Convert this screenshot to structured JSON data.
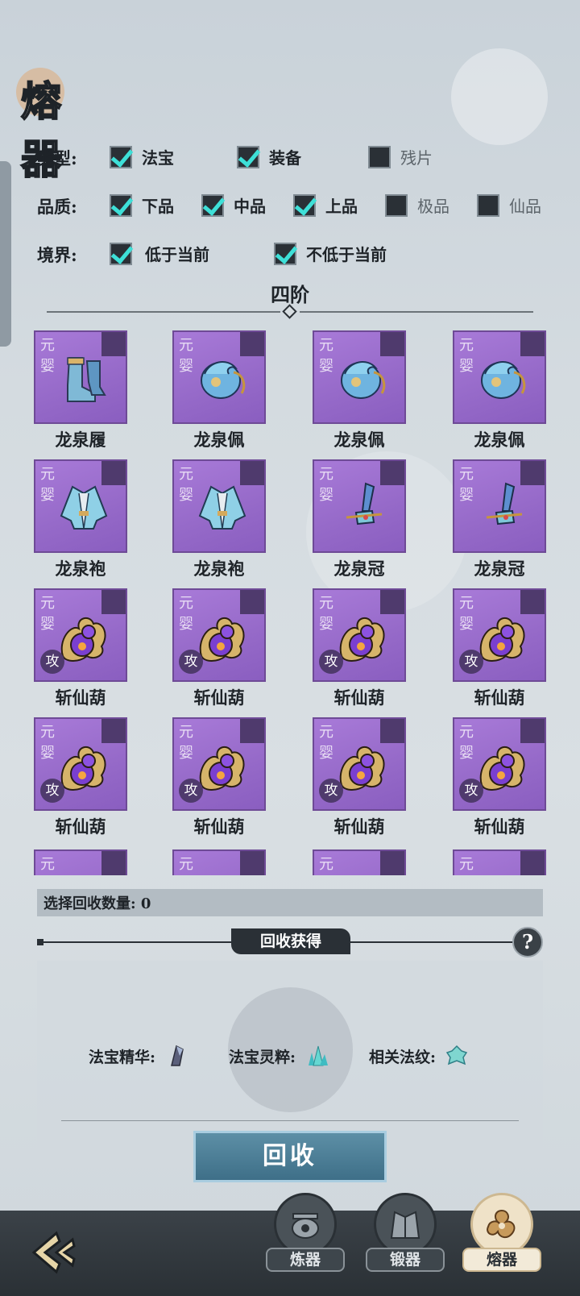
{
  "title": "熔器",
  "filters": {
    "type": {
      "label": "类型:",
      "options": [
        {
          "label": "法宝",
          "checked": true
        },
        {
          "label": "装备",
          "checked": true
        },
        {
          "label": "残片",
          "checked": false
        }
      ]
    },
    "quality": {
      "label": "品质:",
      "options": [
        {
          "label": "下品",
          "checked": true
        },
        {
          "label": "中品",
          "checked": true
        },
        {
          "label": "上品",
          "checked": true
        },
        {
          "label": "极品",
          "checked": false
        },
        {
          "label": "仙品",
          "checked": false
        }
      ]
    },
    "realm": {
      "label": "境界:",
      "options": [
        {
          "label": "低于当前",
          "checked": true
        },
        {
          "label": "不低于当前",
          "checked": true
        }
      ]
    }
  },
  "section_title": "四阶",
  "items": [
    {
      "name": "龙泉履",
      "realm": "元婴",
      "art": "boots-icon",
      "tag": ""
    },
    {
      "name": "龙泉佩",
      "realm": "元婴",
      "art": "dragon-pendant-icon",
      "tag": ""
    },
    {
      "name": "龙泉佩",
      "realm": "元婴",
      "art": "dragon-pendant-icon",
      "tag": ""
    },
    {
      "name": "龙泉佩",
      "realm": "元婴",
      "art": "dragon-pendant-icon",
      "tag": ""
    },
    {
      "name": "龙泉袍",
      "realm": "元婴",
      "art": "robe-icon",
      "tag": ""
    },
    {
      "name": "龙泉袍",
      "realm": "元婴",
      "art": "robe-icon",
      "tag": ""
    },
    {
      "name": "龙泉冠",
      "realm": "元婴",
      "art": "crown-icon",
      "tag": ""
    },
    {
      "name": "龙泉冠",
      "realm": "元婴",
      "art": "crown-icon",
      "tag": ""
    },
    {
      "name": "斩仙葫",
      "realm": "元婴",
      "art": "gourd-icon",
      "tag": "攻"
    },
    {
      "name": "斩仙葫",
      "realm": "元婴",
      "art": "gourd-icon",
      "tag": "攻"
    },
    {
      "name": "斩仙葫",
      "realm": "元婴",
      "art": "gourd-icon",
      "tag": "攻"
    },
    {
      "name": "斩仙葫",
      "realm": "元婴",
      "art": "gourd-icon",
      "tag": "攻"
    },
    {
      "name": "斩仙葫",
      "realm": "元婴",
      "art": "gourd-icon",
      "tag": "攻"
    },
    {
      "name": "斩仙葫",
      "realm": "元婴",
      "art": "gourd-icon",
      "tag": "攻"
    },
    {
      "name": "斩仙葫",
      "realm": "元婴",
      "art": "gourd-icon",
      "tag": "攻"
    },
    {
      "name": "斩仙葫",
      "realm": "元婴",
      "art": "gourd-icon",
      "tag": "攻"
    },
    {
      "name": "",
      "realm": "元",
      "art": "",
      "tag": ""
    },
    {
      "name": "",
      "realm": "元",
      "art": "",
      "tag": ""
    },
    {
      "name": "",
      "realm": "元",
      "art": "",
      "tag": ""
    },
    {
      "name": "",
      "realm": "元",
      "art": "",
      "tag": ""
    }
  ],
  "count_label": "选择回收数量: 0",
  "reward_title": "回收获得",
  "help_label": "?",
  "rewards": [
    {
      "label": "法宝精华:",
      "icon": "crystal-shard-icon"
    },
    {
      "label": "法宝灵粹:",
      "icon": "teal-crystal-icon"
    },
    {
      "label": "相关法纹:",
      "icon": "pattern-icon"
    }
  ],
  "recycle_button": "回收",
  "nav": [
    {
      "label": "炼器",
      "icon": "refine-icon",
      "active": false
    },
    {
      "label": "锻器",
      "icon": "forge-icon",
      "active": false
    },
    {
      "label": "熔器",
      "icon": "smelt-icon",
      "active": true
    }
  ],
  "colors": {
    "accent_check": "#3ee0d8",
    "card_purple": "#9a6dcc",
    "button_blue": "#4a7f98"
  }
}
